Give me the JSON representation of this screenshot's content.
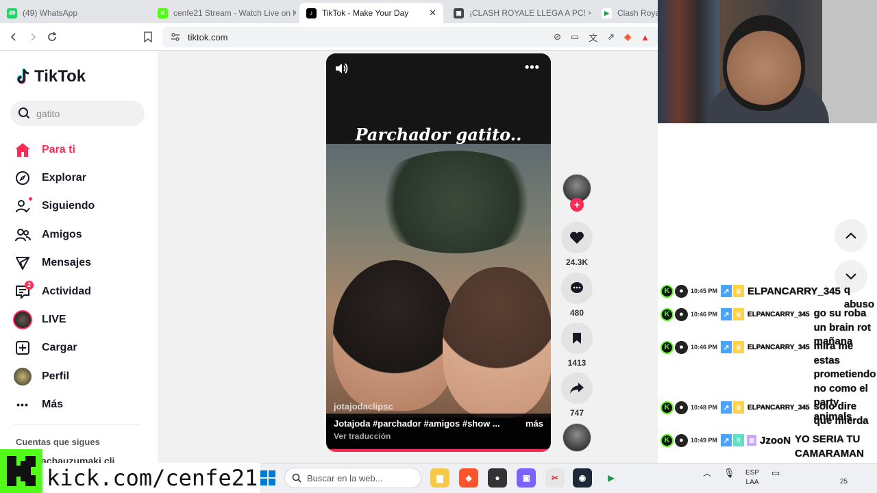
{
  "browser": {
    "tabs": [
      {
        "label": "(49) WhatsApp",
        "icon": "whatsapp-icon",
        "color": "#25d366",
        "fav": "49"
      },
      {
        "label": "cenfe21 Stream - Watch Live on K",
        "icon": "kick-icon",
        "color": "#53fc18",
        "fav": "K"
      },
      {
        "label": "TikTok - Make Your Day",
        "icon": "tiktok-icon",
        "color": "#000000",
        "fav": "♪"
      },
      {
        "label": "¡CLASH ROYALE LLEGA A PC! × CI",
        "icon": "youtube-icon",
        "color": "#444444",
        "fav": "▣"
      },
      {
        "label": "Clash Royale",
        "icon": "play-store-icon",
        "color": "#ffffff",
        "fav": "▶"
      }
    ],
    "active_tab": 2,
    "close_glyph": "✕",
    "url": "tiktok.com"
  },
  "tiktok": {
    "logo": "TikTok",
    "search_value": "gatito",
    "nav": [
      {
        "label": "Para ti",
        "icon": "home-icon",
        "active": true
      },
      {
        "label": "Explorar",
        "icon": "compass-icon"
      },
      {
        "label": "Siguiendo",
        "icon": "following-icon",
        "dot": true
      },
      {
        "label": "Amigos",
        "icon": "friends-icon"
      },
      {
        "label": "Mensajes",
        "icon": "send-icon"
      },
      {
        "label": "Actividad",
        "icon": "activity-icon",
        "badge": "2"
      },
      {
        "label": "LIVE",
        "icon": "live-avatar-icon"
      },
      {
        "label": "Cargar",
        "icon": "upload-icon"
      },
      {
        "label": "Perfil",
        "icon": "profile-avatar-icon"
      },
      {
        "label": "Más",
        "icon": "more-icon"
      }
    ],
    "following_header": "Cuentas que sigues",
    "following_first": "achauzumaki cli",
    "video": {
      "overlay_title": "Parchador gatito..",
      "watermark": "jotajodaclipsc",
      "description": "Jotajoda #parchador #amigos #show ...",
      "more": "más",
      "translate": "Ver traducción"
    },
    "actions": {
      "likes": "24.3K",
      "comments": "480",
      "saves": "1413",
      "shares": "747"
    },
    "accent": "#fe2c55"
  },
  "overlay": {
    "kick_url": "kick.com/cenfe21",
    "kick_color": "#53fc18"
  },
  "chat": [
    {
      "time": "10:45 PM",
      "user": "ELPANCARRY_345",
      "text": "q abuso",
      "big": true
    },
    {
      "time": "10:46 PM",
      "user": "ELPANCARRY_345",
      "text": "go su roba un brain rot mañana"
    },
    {
      "time": "10:46 PM",
      "user": "ELPANCARRY_345",
      "text": "mira me estas prometiendo no como el party animals"
    },
    {
      "time": "10:48 PM",
      "user": "ELPANCARRY_345",
      "text": "solo dire que mierda"
    },
    {
      "time": "10:49 PM",
      "user": "JzooN",
      "text": "YO SERIA TU CAMARAMAN PERO ESTOY RE LEJOS XD",
      "big": true,
      "extra_badges": true
    }
  ],
  "taskbar": {
    "search_placeholder": "Buscar en la web...",
    "lang_top": "ESP",
    "lang_bottom": "LAA",
    "clock_fragment": "25"
  }
}
